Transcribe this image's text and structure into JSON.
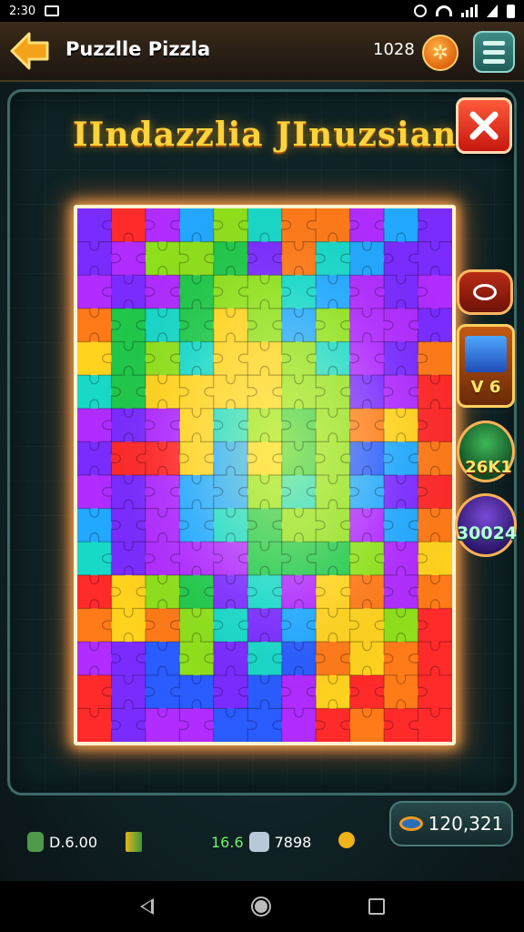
{
  "status_bar": {
    "time": "2:30"
  },
  "header": {
    "title": "Puzzlle Pizzla",
    "coins": "1028"
  },
  "panel": {
    "puzzle_title": "IIndazzlia JInuzsian"
  },
  "side_rewards": {
    "card_label": "V 6",
    "monster_label": "26K1",
    "gem_label": "30024"
  },
  "bottom": {
    "stat_a": "D.6.00",
    "stat_b": "16.6",
    "stat_c": "7898",
    "total": "120,321"
  },
  "colors": {
    "accent": "#ffd43a",
    "close": "#e0261a",
    "panel_border": "#3c6a68",
    "board_glow": "#ffaa50"
  },
  "icons": [
    "back-arrow-icon",
    "coin-icon",
    "menu-icon",
    "close-icon",
    "stop-icon",
    "potion-icon",
    "arrow-icon",
    "robot-icon",
    "key-icon",
    "eye-icon"
  ]
}
